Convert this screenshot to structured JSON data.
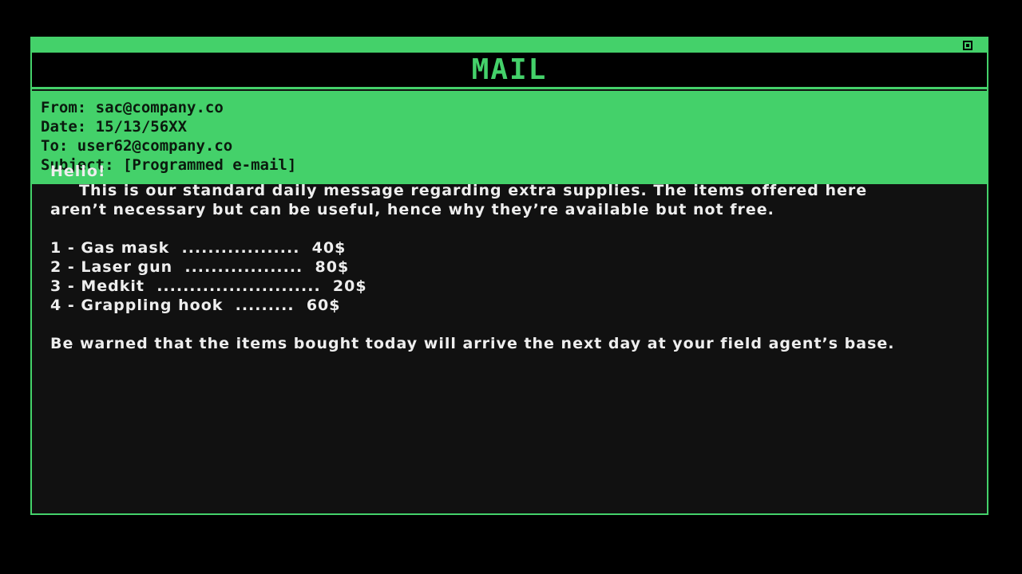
{
  "window": {
    "title": "MAIL",
    "close_icon": "close-square-icon"
  },
  "colors": {
    "accent": "#44d16a",
    "background": "#000000",
    "panel": "#111111",
    "text": "#eeeeee"
  },
  "header": {
    "from": "From: sac@company.co",
    "date": "Date: 15/13/56XX",
    "to": "To: user62@company.co",
    "subject": "Subject: [Programmed e-mail]"
  },
  "body": {
    "greeting": "Hello!",
    "intro": "This is our standard daily message regarding extra supplies. The items offered here aren’t necessary but can be useful, hence why they’re available but not free.",
    "items": [
      {
        "number": "1",
        "name": "Gas mask",
        "dots": "..................",
        "price": "40$"
      },
      {
        "number": "2",
        "name": "Laser gun",
        "dots": "..................",
        "price": "80$"
      },
      {
        "number": "3",
        "name": "Medkit",
        "dots": ".........................",
        "price": "20$"
      },
      {
        "number": "4",
        "name": "Grappling hook",
        "dots": ".........",
        "price": "60$"
      }
    ],
    "warning": "Be warned that the items bought today will arrive the next day at your field agent’s base."
  }
}
